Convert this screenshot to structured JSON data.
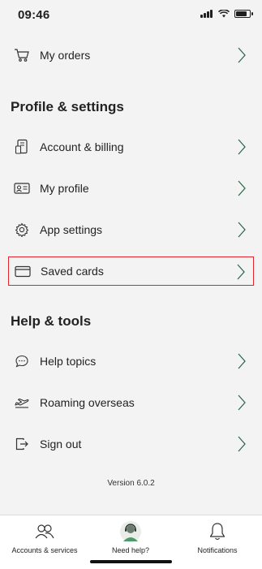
{
  "status_bar": {
    "time": "09:46"
  },
  "menu": {
    "my_orders": "My orders",
    "profile_section_title": "Profile & settings",
    "account_billing": "Account & billing",
    "my_profile": "My profile",
    "app_settings": "App settings",
    "saved_cards": "Saved cards",
    "help_section_title": "Help & tools",
    "help_topics": "Help topics",
    "roaming_overseas": "Roaming overseas",
    "sign_out": "Sign out"
  },
  "version": "Version 6.0.2",
  "tabbar": {
    "accounts_services": "Accounts & services",
    "need_help": "Need help?",
    "notifications": "Notifications"
  },
  "colors": {
    "highlight": "#e1252e",
    "chevron": "#2f6b4f",
    "background": "#f3f3f3"
  }
}
